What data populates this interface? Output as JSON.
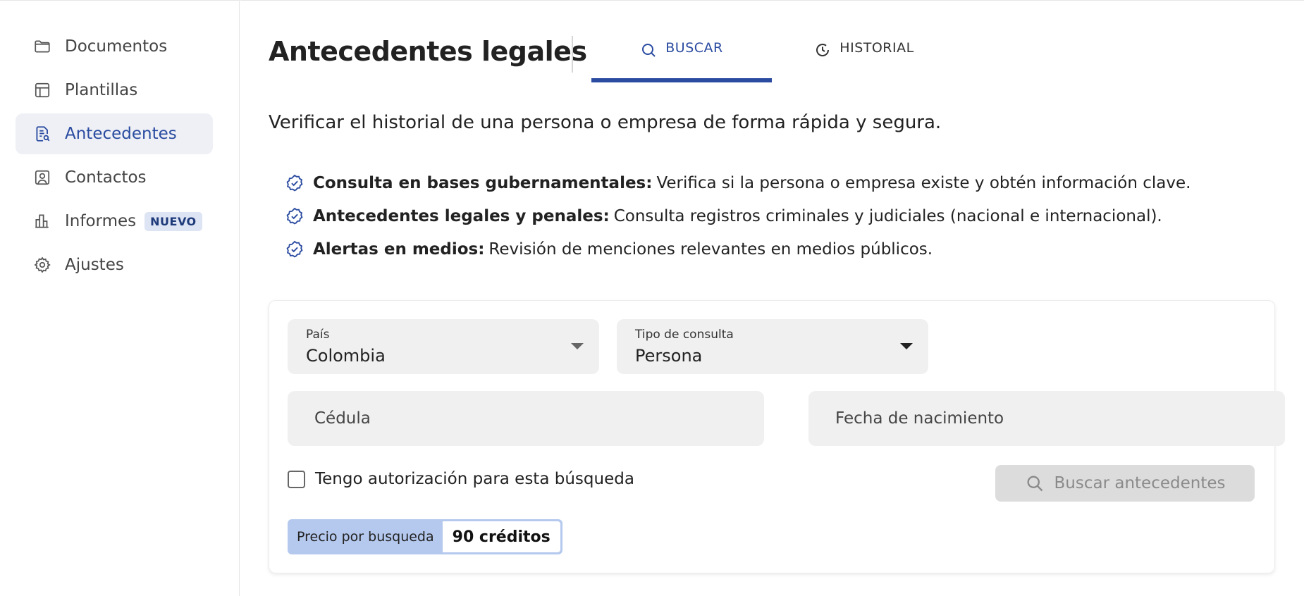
{
  "sidebar": {
    "items": [
      {
        "label": "Documentos",
        "icon": "folder-icon"
      },
      {
        "label": "Plantillas",
        "icon": "template-icon"
      },
      {
        "label": "Antecedentes",
        "icon": "document-search-icon",
        "active": true
      },
      {
        "label": "Contactos",
        "icon": "contact-icon"
      },
      {
        "label": "Informes",
        "icon": "bar-chart-icon",
        "badge": "NUEVO"
      },
      {
        "label": "Ajustes",
        "icon": "gear-icon"
      }
    ]
  },
  "header": {
    "title": "Antecedentes legales",
    "tabs": [
      {
        "label": "BUSCAR",
        "icon": "search-icon",
        "active": true
      },
      {
        "label": "HISTORIAL",
        "icon": "history-icon"
      }
    ]
  },
  "intro": {
    "subtitle": "Verificar el historial de una persona o empresa de forma rápida y segura.",
    "features": [
      {
        "title": "Consulta en bases gubernamentales:",
        "text": "Verifica si la persona o empresa existe y obtén información clave."
      },
      {
        "title": "Antecedentes legales y penales:",
        "text": "Consulta registros criminales y judiciales (nacional e internacional)."
      },
      {
        "title": "Alertas en medios:",
        "text": "Revisión de menciones relevantes en medios públicos."
      }
    ]
  },
  "form": {
    "country": {
      "label": "País",
      "value": "Colombia"
    },
    "query_type": {
      "label": "Tipo de consulta",
      "value": "Persona"
    },
    "id_field": {
      "placeholder": "Cédula"
    },
    "birthdate_field": {
      "placeholder": "Fecha de nacimiento"
    },
    "authorization_label": "Tengo autorización para esta búsqueda",
    "search_button": "Buscar antecedentes",
    "price_label": "Precio por busqueda",
    "price_value": "90 créditos"
  },
  "colors": {
    "accent": "#2a4ba0",
    "active_bg": "#eef0f5",
    "price_bg": "#b5c9ee"
  }
}
